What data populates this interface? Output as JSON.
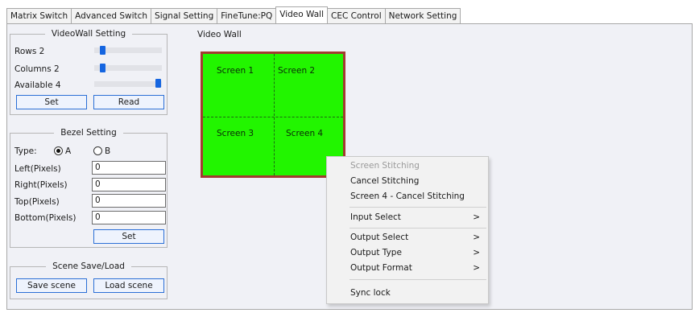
{
  "tabs": [
    {
      "label": "Matrix Switch"
    },
    {
      "label": "Advanced Switch"
    },
    {
      "label": "Signal Setting"
    },
    {
      "label": "FineTune:PQ"
    },
    {
      "label": "Video Wall"
    },
    {
      "label": "CEC Control"
    },
    {
      "label": "Network Setting"
    }
  ],
  "videowall_setting": {
    "legend": "VideoWall Setting",
    "rows_label": "Rows 2",
    "rows_level": 0.1,
    "columns_label": "Columns 2",
    "columns_level": 0.1,
    "available_label": "Available 4",
    "available_level": 1.0,
    "set_label": "Set",
    "read_label": "Read"
  },
  "bezel_setting": {
    "legend": "Bezel Setting",
    "type_label": "Type:",
    "option_a": "A",
    "option_b": "B",
    "selected": "A",
    "left_label": "Left(Pixels)",
    "left_value": "0",
    "right_label": "Right(Pixels)",
    "right_value": "0",
    "top_label": "Top(Pixels)",
    "top_value": "0",
    "bottom_label": "Bottom(Pixels)",
    "bottom_value": "0",
    "set_label": "Set"
  },
  "scene": {
    "legend": "Scene Save/Load",
    "save_label": "Save scene",
    "load_label": "Load scene"
  },
  "video_wall": {
    "title": "Video Wall",
    "screens": [
      "Screen 1",
      "Screen 2",
      "Screen 3",
      "Screen 4"
    ],
    "screen_color": "#22f500",
    "border_color": "#a23a30"
  },
  "context_menu": {
    "items": [
      {
        "label": "Screen Stitching",
        "disabled": true
      },
      {
        "label": "Cancel Stitching"
      },
      {
        "label": "Screen 4 - Cancel Stitching"
      },
      {
        "label": "Input Select",
        "submenu": ">"
      },
      {
        "label": "Output Select",
        "submenu": ">"
      },
      {
        "label": "Output Type",
        "submenu": ">"
      },
      {
        "label": "Output Format",
        "submenu": ">"
      },
      {
        "label": "Sync lock"
      }
    ]
  },
  "colors": {
    "accent": "#1565e0",
    "panel_bg": "#f0f1f6"
  }
}
